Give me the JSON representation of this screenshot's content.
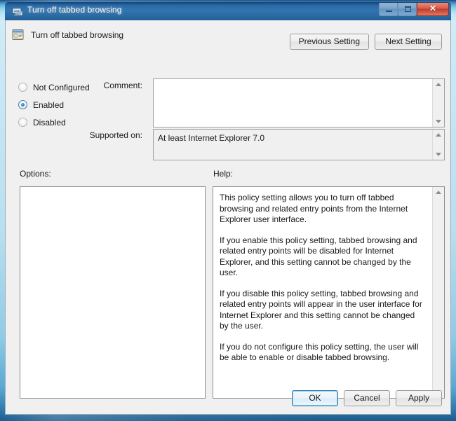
{
  "window": {
    "title": "Turn off tabbed browsing",
    "icon": "policy-setting-icon",
    "minimize_glyph": "minimize-icon",
    "maximize_glyph": "maximize-icon",
    "close_glyph": "close-icon",
    "accent_color": "#2b6aa6",
    "close_color": "#c23a2c",
    "client_background": "#f0f0f0"
  },
  "header": {
    "policy_name": "Turn off tabbed browsing",
    "icon": "group-policy-setting-icon",
    "previous_button": "Previous Setting",
    "next_button": "Next Setting"
  },
  "state": {
    "options": [
      {
        "label": "Not Configured",
        "selected": false
      },
      {
        "label": "Enabled",
        "selected": true
      },
      {
        "label": "Disabled",
        "selected": false
      }
    ]
  },
  "comment": {
    "label": "Comment:",
    "value": "",
    "scrollbar": "vertical-scrollbar"
  },
  "supported_on": {
    "label": "Supported on:",
    "value": "At least Internet Explorer 7.0",
    "scrollbar": "vertical-scrollbar"
  },
  "options_panel": {
    "label": "Options:",
    "content": ""
  },
  "help_panel": {
    "label": "Help:",
    "paragraphs": [
      "This policy setting allows you to turn off tabbed browsing and related entry points from the Internet Explorer user interface.",
      "If you enable this policy setting, tabbed browsing and related entry points will be disabled for Internet Explorer, and this setting cannot be changed by the user.",
      "If you disable this policy setting, tabbed browsing and related entry points will appear in the user interface for Internet Explorer and this setting cannot be changed by the user.",
      "If you do not configure this policy setting, the user will be able to enable or disable tabbed browsing."
    ],
    "scrollbar": "vertical-scrollbar"
  },
  "footer": {
    "ok_label": "OK",
    "cancel_label": "Cancel",
    "apply_label": "Apply",
    "default_button": "OK"
  }
}
